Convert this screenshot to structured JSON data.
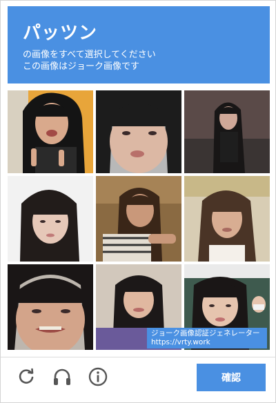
{
  "header": {
    "title": "パッツン",
    "instruction_line1": "の画像をすべて選択してください",
    "instruction_line2": "この画像はジョーク画像です",
    "color": "#4a90e2"
  },
  "grid": {
    "rows": 3,
    "cols": 3,
    "tiles": [
      {
        "position": "row1-col1",
        "selected": false
      },
      {
        "position": "row1-col2",
        "selected": false
      },
      {
        "position": "row1-col3",
        "selected": false
      },
      {
        "position": "row2-col1",
        "selected": false
      },
      {
        "position": "row2-col2",
        "selected": false
      },
      {
        "position": "row2-col3",
        "selected": false
      },
      {
        "position": "row3-col1",
        "selected": false
      },
      {
        "position": "row3-col2",
        "selected": false
      },
      {
        "position": "row3-col3",
        "selected": false
      }
    ]
  },
  "watermark": {
    "line1": "ジョーク画像認証ジェネレーター",
    "line2": "https://vrty.work"
  },
  "footer": {
    "icons": [
      "reload-icon",
      "headphones-icon",
      "info-icon"
    ],
    "verify_label": "確認"
  }
}
